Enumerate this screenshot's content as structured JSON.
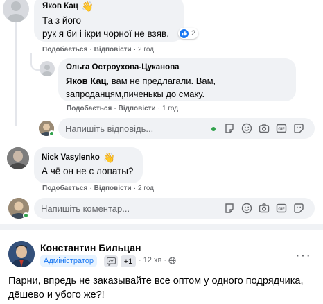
{
  "comments": [
    {
      "author": "Яков Кац",
      "text_lines": [
        "Та з його",
        "рук я би і ікри чорної не взяв."
      ],
      "reaction_count": "2",
      "actions": {
        "like": "Подобається",
        "reply": "Відповісти",
        "time": "2 год"
      }
    },
    {
      "author": "Ольга Остроухова-Цуканова",
      "mention": "Яков Кац",
      "text_first": ", вам не предлагали. Вам,",
      "text_second": "запроданцям,пиченькы до смаку.",
      "actions": {
        "like": "Подобається",
        "reply": "Відповісти",
        "time": "1 год"
      }
    },
    {
      "author": "Nick Vasylenko",
      "text": "А чё он не с лопаты?",
      "actions": {
        "like": "Подобається",
        "reply": "Відповісти",
        "time": "2 год"
      }
    }
  ],
  "reply_input": {
    "placeholder": "Напишіть відповідь..."
  },
  "comment_input": {
    "placeholder": "Напишіть коментар..."
  },
  "post": {
    "author": "Константин Бильцан",
    "badge": "Адміністратор",
    "plus": "+1",
    "time": "12 хв",
    "text": "Парни, впредь не заказывайте все оптом у одного подрядчика, дёшево и убого же?!",
    "more": "···"
  },
  "separator": "·",
  "colors": {
    "accent": "#1877f2",
    "bubble": "#f0f2f5",
    "meta": "#65676b",
    "online": "#31a24c"
  },
  "icons": [
    "wave-icon",
    "like-icon",
    "sticker-icon",
    "emoji-icon",
    "camera-icon",
    "gif-icon",
    "sticker-face-icon",
    "more-icon",
    "globe-icon",
    "chat-icon"
  ]
}
